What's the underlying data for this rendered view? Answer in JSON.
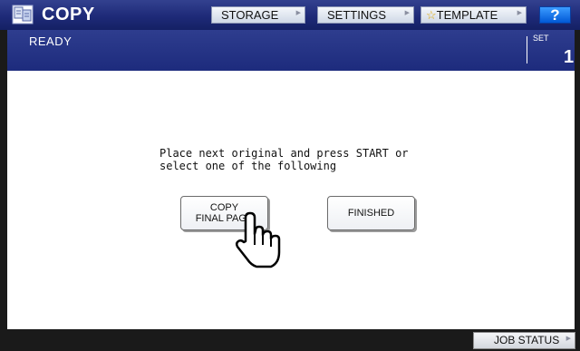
{
  "header": {
    "title": "COPY",
    "buttons": [
      {
        "label": "STORAGE"
      },
      {
        "label": "SETTINGS"
      },
      {
        "label": "TEMPLATE"
      }
    ],
    "help_label": "?"
  },
  "status": {
    "text": "READY",
    "set_label": "SET",
    "set_value": "1"
  },
  "main": {
    "message_line1": "Place next original and press START or",
    "message_line2": "select one of the following",
    "copy_final_line1": "COPY",
    "copy_final_line2": "FINAL PAGE",
    "finished_label": "FINISHED"
  },
  "footer": {
    "job_status_label": "JOB STATUS"
  },
  "colors": {
    "title_bar": "#1e2a78",
    "help_button": "#0058d6",
    "frame": "#1a1a1a"
  },
  "icons": [
    "copy-app-icon",
    "star-icon",
    "arrow-icon",
    "hand-pointer-icon"
  ]
}
